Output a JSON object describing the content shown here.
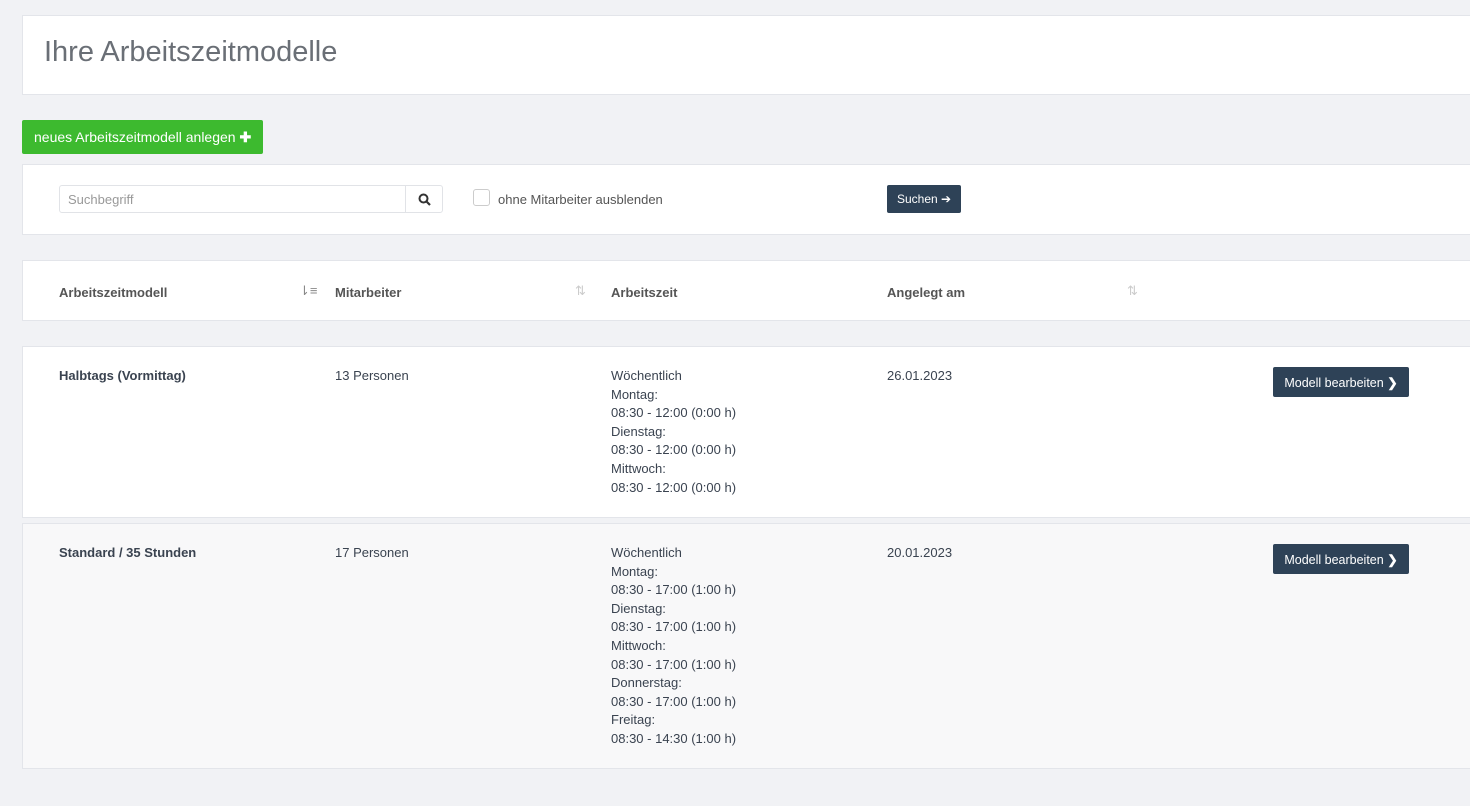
{
  "page_title": "Ihre Arbeitszeitmodelle",
  "new_button": "neues Arbeitszeitmodell anlegen",
  "search": {
    "placeholder": "Suchbegriff",
    "checkbox_label": "ohne Mitarbeiter ausblenden",
    "checked": false,
    "submit": "Suchen"
  },
  "columns": [
    "Arbeitszeitmodell",
    "Mitarbeiter",
    "Arbeitszeit",
    "Angelegt am"
  ],
  "rows": [
    {
      "name": "Halbtags (Vormittag)",
      "employees": "13 Personen",
      "schedule": [
        "Wöchentlich",
        "Montag:",
        "08:30 - 12:00 (0:00 h)",
        "Dienstag:",
        "08:30 - 12:00 (0:00 h)",
        "Mittwoch:",
        "08:30 - 12:00 (0:00 h)"
      ],
      "created": "26.01.2023",
      "action": "Modell bearbeiten"
    },
    {
      "name": "Standard / 35 Stunden",
      "employees": "17 Personen",
      "schedule": [
        "Wöchentlich",
        "Montag:",
        "08:30 - 17:00 (1:00 h)",
        "Dienstag:",
        "08:30 - 17:00 (1:00 h)",
        "Mittwoch:",
        "08:30 - 17:00 (1:00 h)",
        "Donnerstag:",
        "08:30 - 17:00 (1:00 h)",
        "Freitag:",
        "08:30 - 14:30 (1:00 h)"
      ],
      "created": "20.01.2023",
      "action": "Modell bearbeiten"
    }
  ]
}
